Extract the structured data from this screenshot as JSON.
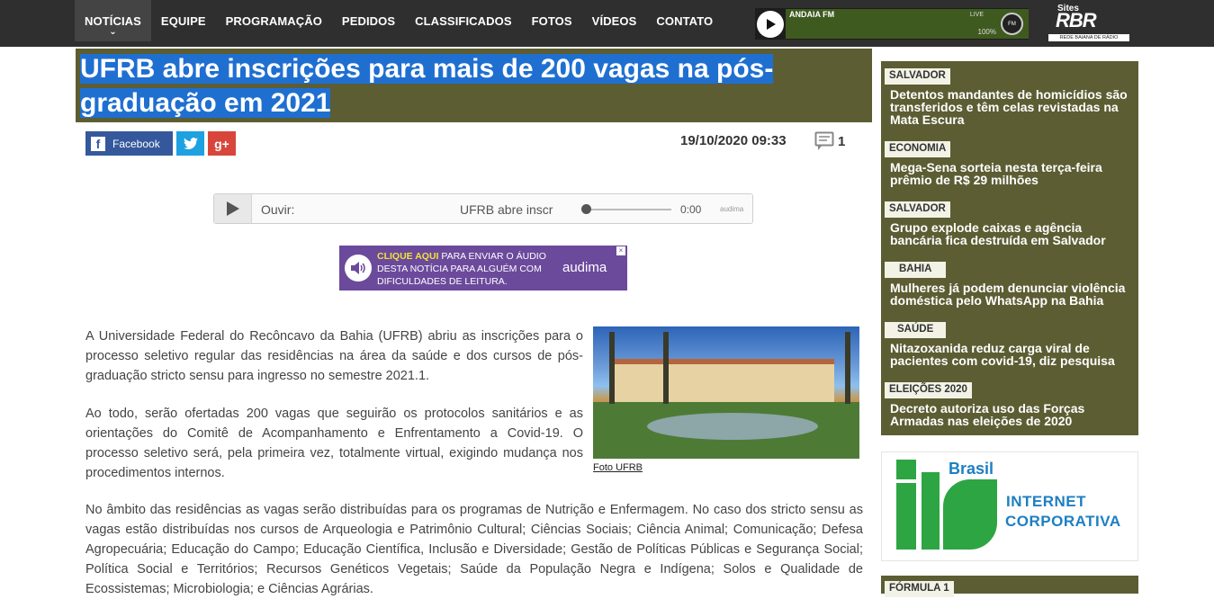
{
  "nav": {
    "items": [
      "NOTÍCIAS",
      "EQUIPE",
      "PROGRAMAÇÃO",
      "PEDIDOS",
      "CLASSIFICADOS",
      "FOTOS",
      "VÍDEOS",
      "CONTATO"
    ],
    "active": "NOTÍCIAS"
  },
  "radio": {
    "station": "ANDAIA FM",
    "live": "LIVE",
    "volume": "100%"
  },
  "brand": {
    "sites": "Sites",
    "name": "RBR",
    "tagline": "REDE BAIANA DE RÁDIO"
  },
  "article": {
    "title": "UFRB abre inscrições para mais de 200 vagas na pós-graduação em 2021",
    "date": "19/10/2020 09:33",
    "comments": "1",
    "share": {
      "facebook": "Facebook"
    },
    "paragraphs": [
      "A Universidade Federal do Recôncavo da Bahia (UFRB) abriu as inscrições para o processo seletivo regular das residências na área da saúde e dos cursos de pós-graduação stricto sensu para ingresso no semestre 2021.1.",
      "Ao todo, serão ofertadas 200 vagas que seguirão os protocolos sanitários e as orientações do Comitê de Acompanhamento e Enfrentamento a Covid-19. O processo seletivo será, pela primeira vez, totalmente virtual, exigindo mudança nos procedimentos internos.",
      "No âmbito das residências as vagas serão distribuídas para os programas de Nutrição e Enfermagem. No caso dos stricto sensu as vagas estão distribuídas nos cursos de Arqueologia e Patrimônio Cultural; Ciências Sociais; Ciência Animal; Comunicação; Defesa Agropecuária; Educação do Campo; Educação Científica, Inclusão e Diversidade; Gestão de Políticas Públicas e Segurança Social; Política Social e Territórios; Recursos Genéticos Vegetais; Saúde da População Negra e Indígena; Solos e Qualidade de Ecossistemas; Microbiologia; e Ciências Agrárias."
    ],
    "photo_caption": "Foto UFRB"
  },
  "player": {
    "label": "Ouvir:",
    "title": "UFRB abre inscr",
    "time": "0:00",
    "brand": "audima",
    "progress_percent": 0
  },
  "ad": {
    "highlight": "CLIQUE AQUI",
    "text": " PARA ENVIAR O ÁUDIO DESTA NOTÍCIA PARA ALGUÉM COM DIFICULDADES DE LEITURA.",
    "brand": "audima"
  },
  "sidebar": {
    "items": [
      {
        "tag": "SALVADOR",
        "title": "Detentos mandantes de homicídios são transferidos e têm celas revistadas na Mata Escura"
      },
      {
        "tag": "ECONOMIA",
        "title": "Mega-Sena sorteia nesta terça-feira prêmio de R$ 29 milhões"
      },
      {
        "tag": "SALVADOR",
        "title": "Grupo explode caixas e agência bancária fica destruída em Salvador"
      },
      {
        "tag": "BAHIA",
        "title": "Mulheres já podem denunciar violência doméstica pelo WhatsApp na Bahia"
      },
      {
        "tag": "SAÚDE",
        "title": "Nitazoxanida reduz carga viral de pacientes com covid-19, diz pesquisa"
      },
      {
        "tag": "ELEIÇÕES 2020",
        "title": "Decreto autoriza uso das Forças Armadas nas eleições de 2020"
      }
    ],
    "next_tag": "FÓRMULA 1"
  },
  "its_ad": {
    "brand": "Brasil",
    "line1": "INTERNET",
    "line2": "CORPORATIVA"
  },
  "colors": {
    "olive": "#5c5d33",
    "selection": "#1f6fd1",
    "facebook": "#34589b",
    "twitter": "#1da1e0",
    "gplus": "#d8463b",
    "its_green": "#2ea543",
    "its_blue": "#1d7fc1"
  }
}
